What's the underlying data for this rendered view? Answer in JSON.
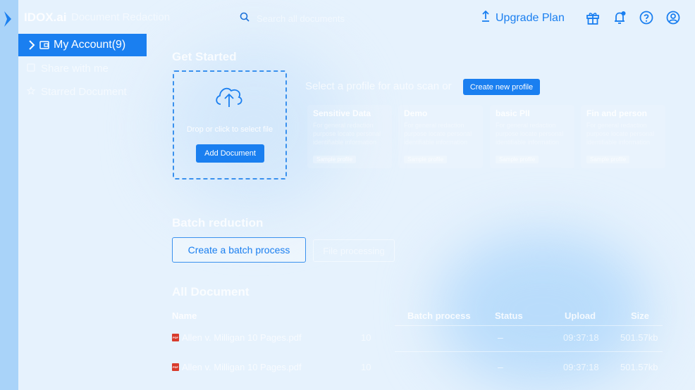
{
  "header": {
    "brand": "IDOX.ai",
    "app_title": "Document Redaction",
    "search_placeholder": "Search all documents",
    "upgrade_label": "Upgrade Plan",
    "icons": [
      "gift-icon",
      "notification-bell-icon",
      "help-icon",
      "user-account-icon"
    ]
  },
  "sidebar": {
    "items": [
      {
        "label": "My Account(9)",
        "icon": "folder-icon",
        "active": true
      },
      {
        "label": "Share with me",
        "icon": "share-icon"
      },
      {
        "label": "Starred Document",
        "icon": "star-icon"
      }
    ]
  },
  "get_started": {
    "title": "Get Started",
    "drop_hint": "Drop or click to select file",
    "add_button": "Add Document",
    "profile_prompt": "Select a profile for auto scan or",
    "new_profile_button": "Create new profile",
    "profiles": [
      {
        "title": "Sensitive Data",
        "description": "For general redaction purpose locate personal identifiable information",
        "tag": "Sample profile"
      },
      {
        "title": "Demo",
        "description": "For general redaction purpose locate personal identifiable information",
        "tag": "Sample profile"
      },
      {
        "title": "basic PII",
        "description": "For general redaction purpose locate personal identifiable information",
        "tag": "Sample profile"
      },
      {
        "title": "Fin and person",
        "description": "For general redaction purpose locate personal identifiable information",
        "tag": "Sample profile"
      }
    ]
  },
  "batch": {
    "title": "Batch reduction",
    "create_button": "Create a batch process",
    "file_processing_button": "File processing"
  },
  "documents": {
    "title": "All Document",
    "columns": [
      "Name",
      "Batch process",
      "Status",
      "Upload",
      "Size"
    ],
    "rows": [
      {
        "name": "Allen v. Milligan 10 Pages.pdf",
        "pages": "10",
        "status": "–",
        "upload": "09:37:18",
        "size": "501.57kb"
      },
      {
        "name": "Allen v. Milligan 10 Pages.pdf",
        "pages": "10",
        "status": "–",
        "upload": "09:37:18",
        "size": "501.57kb"
      }
    ]
  },
  "colors": {
    "accent": "#1a7ff0",
    "background": "#e6f2fd",
    "rail": "#a9d3f9"
  }
}
